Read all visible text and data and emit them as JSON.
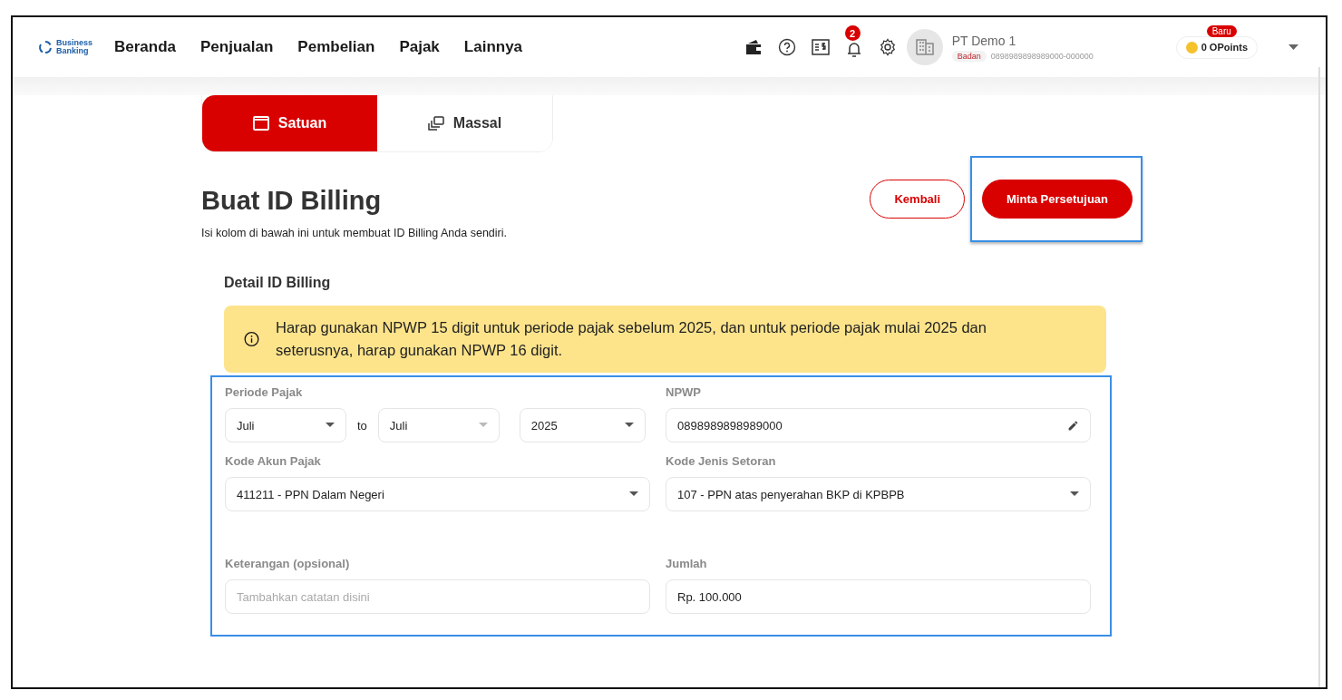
{
  "header": {
    "logo": "Business Banking",
    "nav": [
      {
        "label": "Beranda",
        "selected": false
      },
      {
        "label": "Penjualan",
        "selected": false
      },
      {
        "label": "Pembelian",
        "selected": false
      },
      {
        "label": "Pajak",
        "selected": false
      },
      {
        "label": "Lainnya",
        "selected": false
      }
    ],
    "notification_count": "2",
    "company": {
      "name": "PT Demo 1",
      "type": "Badan",
      "id": "0898989898989000-000000"
    },
    "points": {
      "badge": "Baru",
      "label": "0 OPoints"
    }
  },
  "mode_tabs": [
    {
      "label": "Satuan",
      "kind": "single",
      "selected": true
    },
    {
      "label": "Massal",
      "kind": "bulk",
      "selected": false
    }
  ],
  "page": {
    "title": "Buat ID Billing",
    "subtitle": "Isi kolom di bawah ini untuk membuat ID Billing Anda sendiri.",
    "buttons": [
      {
        "label": "Kembali",
        "kind": "outline",
        "highlighted": false
      },
      {
        "label": "Minta Persetujuan",
        "kind": "primary",
        "highlighted": true
      }
    ]
  },
  "form": {
    "title": "Detail ID Billing",
    "alert": "Harap gunakan NPWP 15 digit untuk periode pajak sebelum 2025, dan untuk periode pajak mulai 2025 dan seterusnya, harap gunakan NPWP 16 digit.",
    "highlighted": true,
    "periode": {
      "label": "Periode Pajak",
      "from": {
        "value": "Juli",
        "disabled": false
      },
      "separator": "to",
      "to": {
        "value": "Juli",
        "disabled": true
      },
      "year": {
        "value": "2025",
        "disabled": false
      }
    },
    "fields": [
      {
        "label": "NPWP",
        "kind": "edit",
        "value": "0898989898989000"
      },
      {
        "label": "Kode Akun Pajak",
        "kind": "select",
        "value": "411211 - PPN Dalam Negeri"
      },
      {
        "label": "Kode Jenis Setoran",
        "kind": "select",
        "value": "107 - PPN atas penyerahan BKP di KPBPB"
      },
      {
        "label": "Keterangan (opsional)",
        "kind": "text",
        "placeholder": "Tambahkan catatan disini"
      },
      {
        "label": "Jumlah",
        "kind": "text",
        "value": "Rp. 100.000"
      }
    ]
  }
}
